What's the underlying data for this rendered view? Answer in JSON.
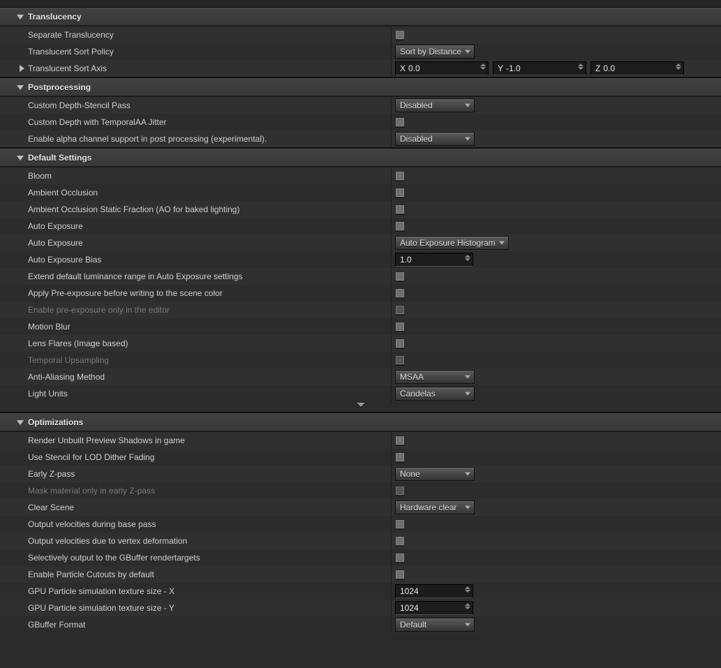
{
  "sections": {
    "translucency": {
      "title": "Translucency",
      "separate_translucency": {
        "label": "Separate Translucency"
      },
      "sort_policy": {
        "label": "Translucent Sort Policy",
        "value": "Sort by Distance"
      },
      "sort_axis": {
        "label": "Translucent Sort Axis",
        "x": "0.0",
        "y": "-1.0",
        "z": "0.0"
      }
    },
    "postprocessing": {
      "title": "Postprocessing",
      "depth_stencil": {
        "label": "Custom Depth-Stencil Pass",
        "value": "Disabled"
      },
      "depth_temporal_jitter": {
        "label": "Custom Depth with TemporalAA Jitter"
      },
      "alpha_channel": {
        "label": "Enable alpha channel support in post processing (experimental).",
        "value": "Disabled"
      }
    },
    "defaults": {
      "title": "Default Settings",
      "bloom": {
        "label": "Bloom"
      },
      "ao": {
        "label": "Ambient Occlusion"
      },
      "ao_static": {
        "label": "Ambient Occlusion Static Fraction (AO for baked lighting)"
      },
      "auto_exposure_cb": {
        "label": "Auto Exposure"
      },
      "auto_exposure_dd": {
        "label": "Auto Exposure",
        "value": "Auto Exposure Histogram"
      },
      "auto_exposure_bias": {
        "label": "Auto Exposure Bias",
        "value": "1.0"
      },
      "extend_luminance": {
        "label": "Extend default luminance range in Auto Exposure settings"
      },
      "apply_preexposure": {
        "label": "Apply Pre-exposure before writing to the scene color"
      },
      "preexposure_editor": {
        "label": "Enable pre-exposure only in the editor"
      },
      "motion_blur": {
        "label": "Motion Blur"
      },
      "lens_flares": {
        "label": "Lens Flares (Image based)"
      },
      "temporal_upsampling": {
        "label": "Temporal Upsampling"
      },
      "aa_method": {
        "label": "Anti-Aliasing Method",
        "value": "MSAA"
      },
      "light_units": {
        "label": "Light Units",
        "value": "Candelas"
      }
    },
    "optimizations": {
      "title": "Optimizations",
      "unbuilt_shadows": {
        "label": "Render Unbuilt Preview Shadows in game"
      },
      "stencil_lod": {
        "label": "Use Stencil for LOD Dither Fading"
      },
      "early_z": {
        "label": "Early Z-pass",
        "value": "None"
      },
      "mask_early_z": {
        "label": "Mask material only in early Z-pass"
      },
      "clear_scene": {
        "label": "Clear Scene",
        "value": "Hardware clear"
      },
      "vel_basepass": {
        "label": "Output velocities during base pass"
      },
      "vel_vertex": {
        "label": "Output velocities due to vertex deformation"
      },
      "gbuffer_select": {
        "label": "Selectively output to the GBuffer rendertargets"
      },
      "particle_cutouts": {
        "label": "Enable Particle Cutouts by default"
      },
      "gpu_particle_x": {
        "label": "GPU Particle simulation texture size - X",
        "value": "1024"
      },
      "gpu_particle_y": {
        "label": "GPU Particle simulation texture size - Y",
        "value": "1024"
      },
      "gbuffer_format": {
        "label": "GBuffer Format",
        "value": "Default"
      }
    }
  }
}
